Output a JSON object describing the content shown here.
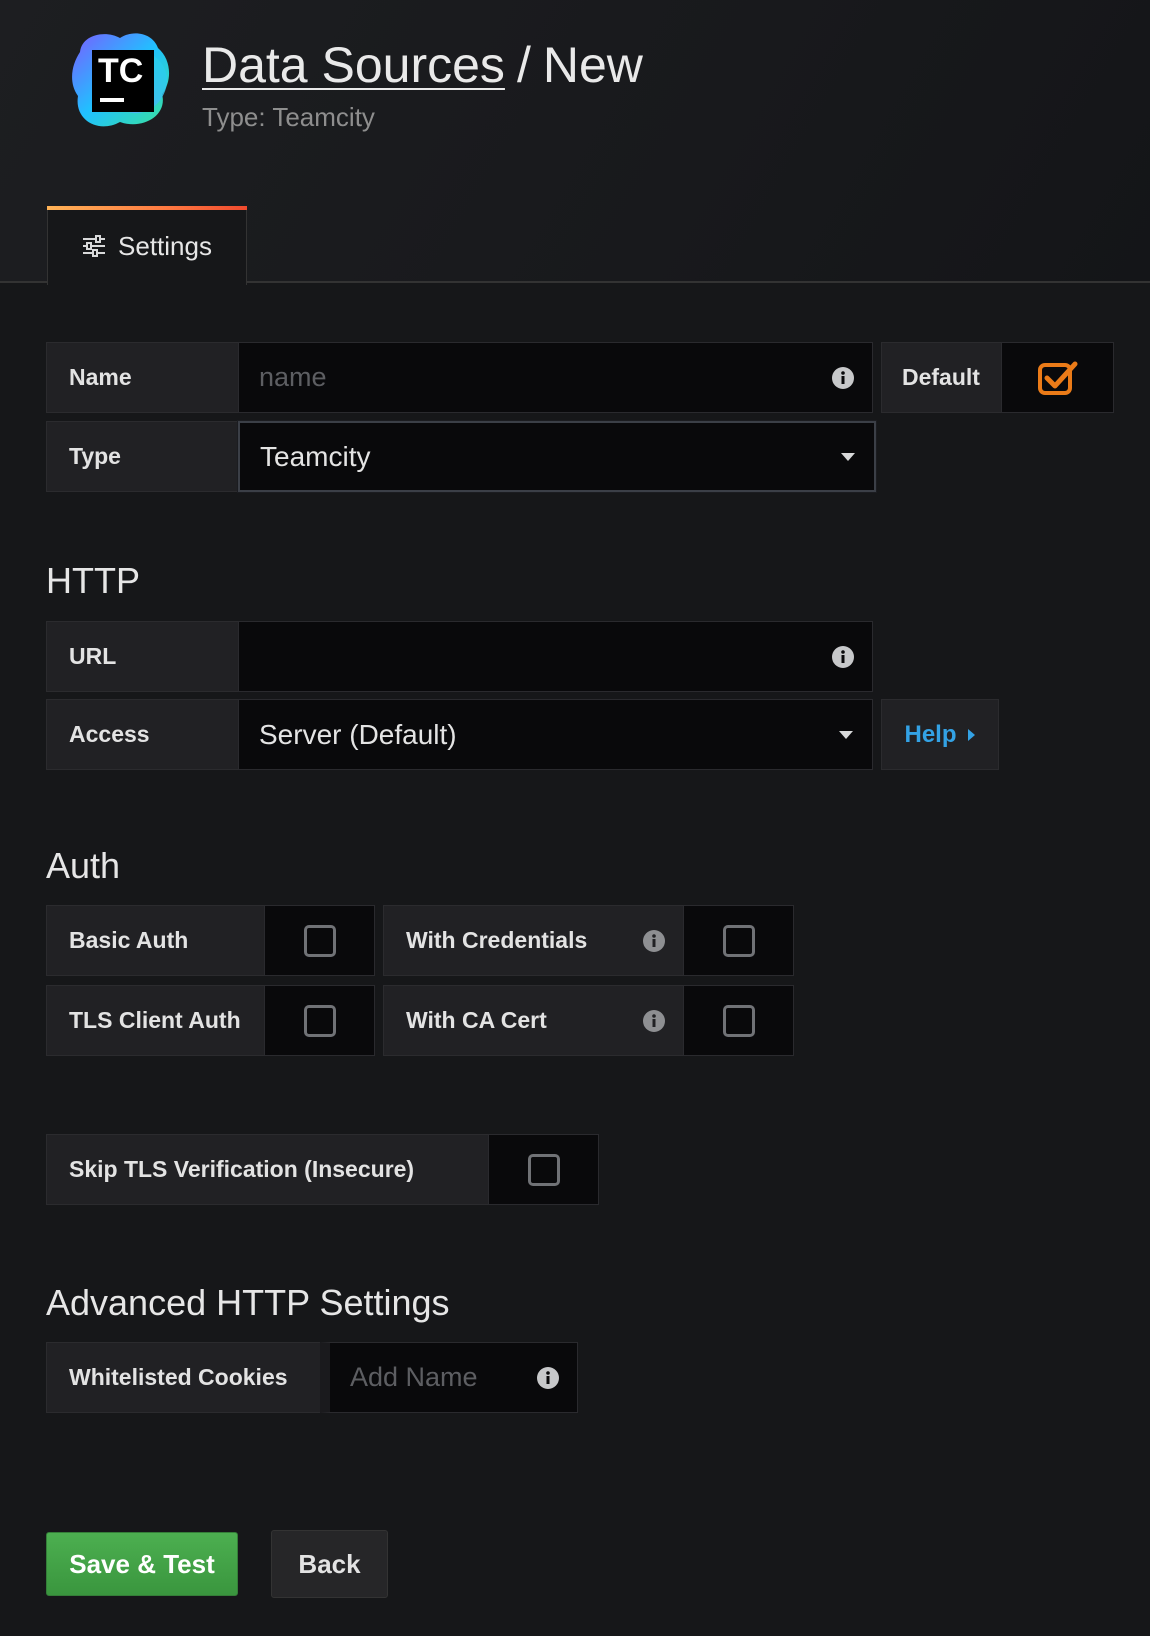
{
  "header": {
    "logo_text": "TC",
    "breadcrumb_link": "Data Sources",
    "breadcrumb_separator": "/",
    "breadcrumb_current": "New",
    "subtitle": "Type: Teamcity"
  },
  "tabs": [
    {
      "label": "Settings",
      "icon": "sliders-icon",
      "active": true
    }
  ],
  "settings": {
    "name_label": "Name",
    "name_placeholder": "name",
    "name_value": "",
    "default_label": "Default",
    "default_checked": true,
    "type_label": "Type",
    "type_value": "Teamcity"
  },
  "http": {
    "title": "HTTP",
    "url_label": "URL",
    "url_value": "",
    "access_label": "Access",
    "access_value": "Server (Default)",
    "help_label": "Help"
  },
  "auth": {
    "title": "Auth",
    "basic_auth_label": "Basic Auth",
    "with_credentials_label": "With Credentials",
    "tls_client_auth_label": "TLS Client Auth",
    "with_ca_cert_label": "With CA Cert",
    "skip_tls_label": "Skip TLS Verification (Insecure)"
  },
  "advanced": {
    "title": "Advanced HTTP Settings",
    "cookies_label": "Whitelisted Cookies",
    "cookies_placeholder": "Add Name"
  },
  "actions": {
    "save_label": "Save & Test",
    "back_label": "Back"
  },
  "colors": {
    "accent_orange": "#eb7b18",
    "link_blue": "#33a2e5",
    "primary_green": "#3f9e43"
  }
}
